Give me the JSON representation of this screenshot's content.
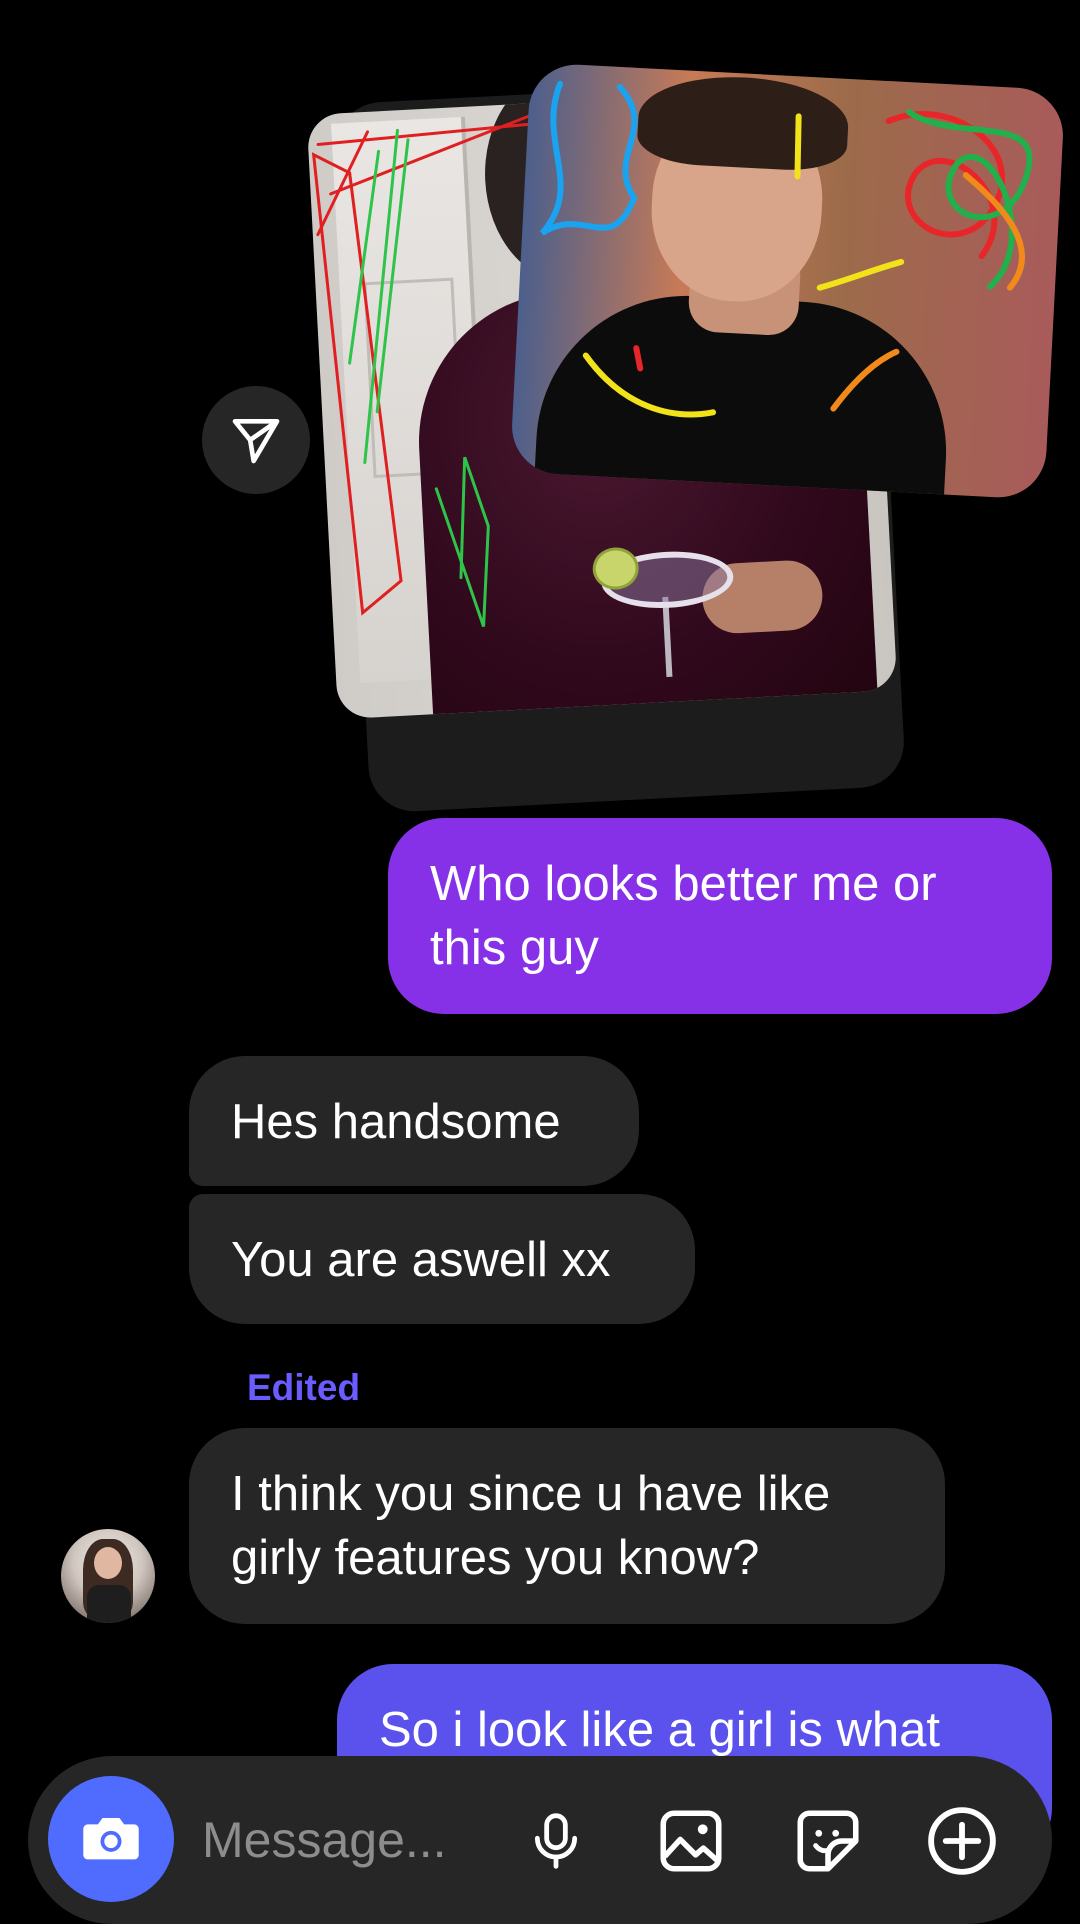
{
  "media": {
    "share_icon": "paper-plane-icon"
  },
  "messages": [
    {
      "direction": "outgoing",
      "text": "Who looks better me or this guy"
    },
    {
      "direction": "incoming",
      "text": "Hes handsome"
    },
    {
      "direction": "incoming",
      "text": "You are aswell xx"
    },
    {
      "direction": "incoming",
      "label": "Edited",
      "text": "I think you since u have like girly features you know?"
    },
    {
      "direction": "outgoing",
      "text": "So i look like a girl is what"
    }
  ],
  "composer": {
    "placeholder": "Message...",
    "camera_icon": "camera-icon",
    "mic_icon": "microphone-icon",
    "gallery_icon": "image-icon",
    "sticker_icon": "sticker-icon",
    "plus_icon": "plus-circle-icon"
  },
  "colors": {
    "background": "#000000",
    "outgoing_bubble": "#8630e8",
    "outgoing_bubble_latest": "#5b52ee",
    "incoming_bubble": "#262626",
    "edited_label": "#6a5cff",
    "camera_button": "#4f6cff"
  }
}
